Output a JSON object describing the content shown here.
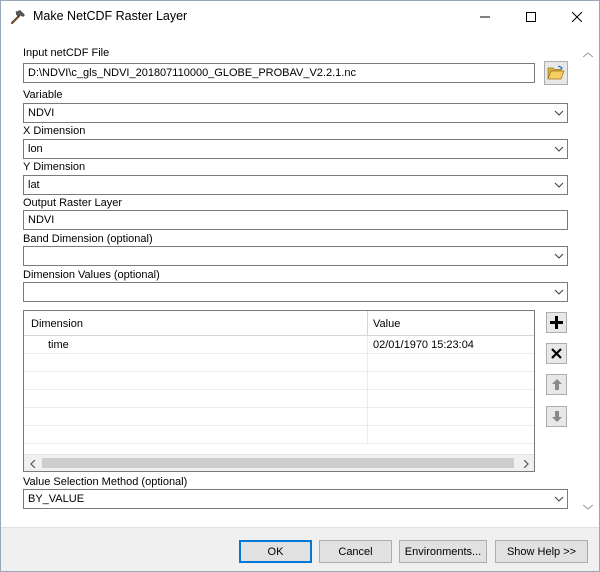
{
  "window": {
    "title": "Make NetCDF Raster Layer"
  },
  "form": {
    "input_file": {
      "label": "Input netCDF File",
      "value": "D:\\NDVI\\c_gls_NDVI_201807110000_GLOBE_PROBAV_V2.2.1.nc"
    },
    "variable": {
      "label": "Variable",
      "value": "NDVI"
    },
    "x_dimension": {
      "label": "X Dimension",
      "value": "lon"
    },
    "y_dimension": {
      "label": "Y Dimension",
      "value": "lat"
    },
    "output_layer": {
      "label": "Output Raster Layer",
      "value": "NDVI"
    },
    "band_dimension": {
      "label": "Band Dimension (optional)",
      "value": ""
    },
    "dimension_values": {
      "label": "Dimension Values (optional)",
      "value": "",
      "columns": [
        "Dimension",
        "Value"
      ],
      "rows": [
        {
          "dimension": "time",
          "value": "02/01/1970 15:23:04"
        }
      ]
    },
    "value_selection": {
      "label": "Value Selection Method (optional)",
      "value": "BY_VALUE"
    }
  },
  "buttons": {
    "ok": "OK",
    "cancel": "Cancel",
    "environments": "Environments...",
    "show_help": "Show Help >>"
  },
  "icons": {
    "app": "hammer-icon",
    "browse": "open-folder-icon",
    "add": "plus-icon",
    "remove": "x-icon",
    "up": "arrow-up-icon",
    "down": "arrow-down-icon"
  }
}
